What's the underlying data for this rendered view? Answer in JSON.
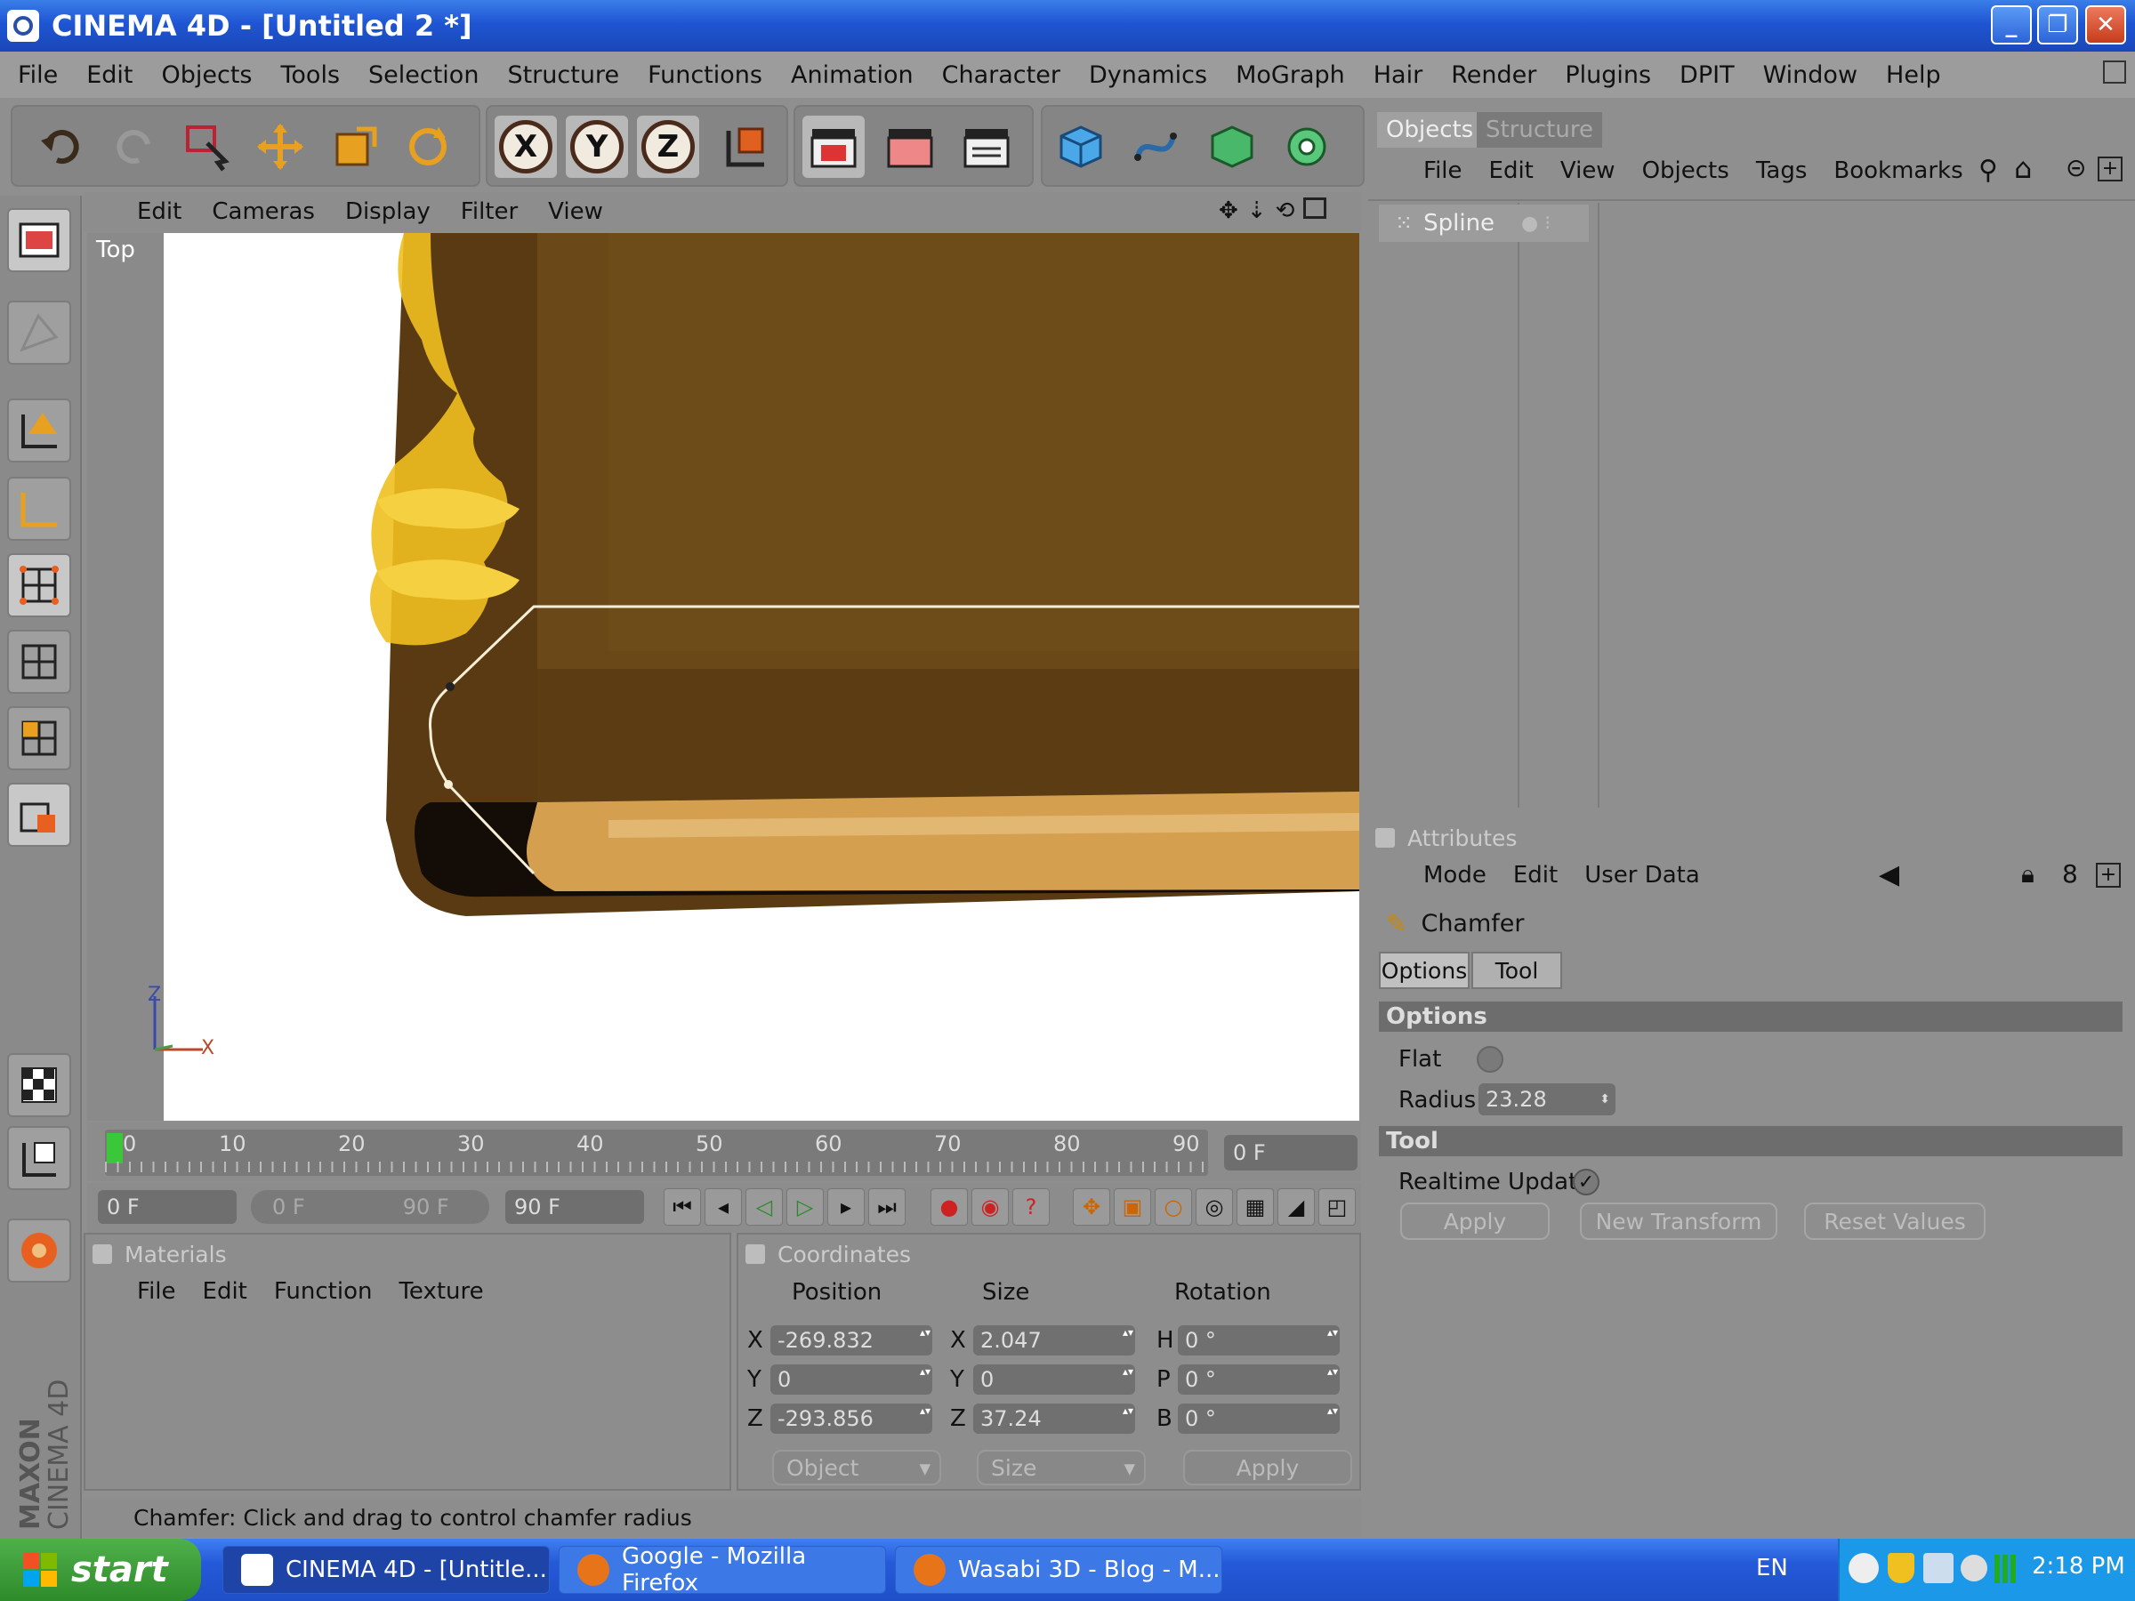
{
  "window": {
    "title": "CINEMA 4D - [Untitled 2 *]",
    "minimize_label": "_",
    "maximize_label": "❐",
    "close_label": "✕"
  },
  "menubar": [
    "File",
    "Edit",
    "Objects",
    "Tools",
    "Selection",
    "Structure",
    "Functions",
    "Animation",
    "Character",
    "Dynamics",
    "MoGraph",
    "Hair",
    "Render",
    "Plugins",
    "DPIT",
    "Window",
    "Help"
  ],
  "toolbar": {
    "axes": [
      "X",
      "Y",
      "Z"
    ]
  },
  "viewport": {
    "menu": [
      "Edit",
      "Cameras",
      "Display",
      "Filter",
      "View"
    ],
    "label": "Top",
    "axis_z": "Z",
    "axis_x": "X"
  },
  "timeline": {
    "ticks": [
      "0",
      "10",
      "20",
      "30",
      "40",
      "50",
      "60",
      "70",
      "80",
      "90"
    ],
    "current_frame": "0 F",
    "start": "0 F",
    "range_start": "0 F",
    "range_end": "90 F",
    "end": "90 F"
  },
  "materials": {
    "title": "Materials",
    "menu": [
      "File",
      "Edit",
      "Function",
      "Texture"
    ]
  },
  "coordinates": {
    "title": "Coordinates",
    "col_position": "Position",
    "col_size": "Size",
    "col_rotation": "Rotation",
    "rows": [
      {
        "pl": "X",
        "pv": "-269.832",
        "sl": "X",
        "sv": "2.047",
        "rl": "H",
        "rv": "0 °"
      },
      {
        "pl": "Y",
        "pv": "0",
        "sl": "Y",
        "sv": "0",
        "rl": "P",
        "rv": "0 °"
      },
      {
        "pl": "Z",
        "pv": "-293.856",
        "sl": "Z",
        "sv": "37.24",
        "rl": "B",
        "rv": "0 °"
      }
    ],
    "mode": "Object",
    "size_mode": "Size",
    "apply": "Apply"
  },
  "status": "Chamfer: Click and drag to control chamfer radius",
  "objects_panel": {
    "tabs": [
      "Objects",
      "Structure"
    ],
    "menu": [
      "File",
      "Edit",
      "View",
      "Objects",
      "Tags",
      "Bookmarks"
    ],
    "item": "Spline"
  },
  "attributes": {
    "title": "Attributes",
    "menu": [
      "Mode",
      "Edit",
      "User Data"
    ],
    "tool_name": "Chamfer",
    "tabs": [
      "Options",
      "Tool"
    ],
    "options_section": "Options",
    "flat_label": "Flat",
    "radius_label": "Radius",
    "radius_value": "23.28",
    "tool_section": "Tool",
    "realtime_label": "Realtime Update",
    "apply": "Apply",
    "new_transform": "New Transform",
    "reset": "Reset Values"
  },
  "taskbar": {
    "start": "start",
    "tasks": [
      "CINEMA 4D - [Untitle...",
      "Google - Mozilla Firefox",
      "Wasabi 3D - Blog - M..."
    ],
    "lang": "EN",
    "clock": "2:18 PM"
  }
}
